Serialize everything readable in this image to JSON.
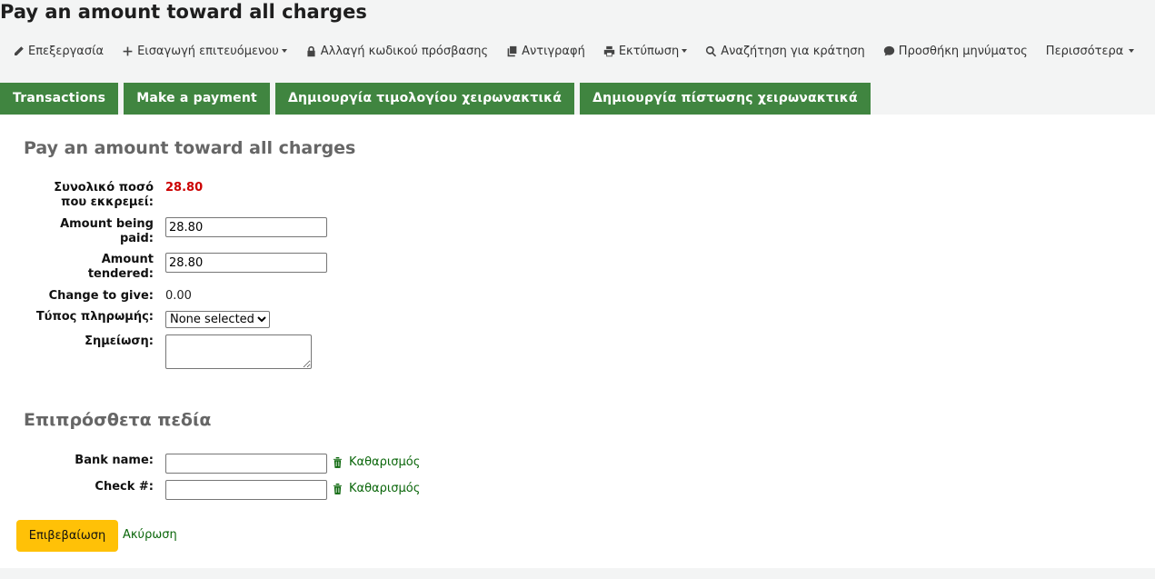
{
  "page": {
    "title": "Pay an amount toward all charges"
  },
  "toolbar": {
    "items": [
      {
        "label": "Επεξεργασία",
        "icon": "pencil-icon"
      },
      {
        "label": "Εισαγωγή επιτευόμενου",
        "icon": "plus-icon"
      },
      {
        "label": "Αλλαγή κωδικού πρόσβασης",
        "icon": "lock-icon"
      },
      {
        "label": "Αντιγραφή",
        "icon": "copy-icon"
      },
      {
        "label": "Εκτύπωση",
        "icon": "print-icon"
      },
      {
        "label": "Αναζήτηση για κράτηση",
        "icon": "search-icon"
      },
      {
        "label": "Προσθήκη μηνύματος",
        "icon": "comment-icon"
      },
      {
        "label": "Περισσότερα",
        "icon": ""
      }
    ]
  },
  "tabs": [
    {
      "label": "Transactions"
    },
    {
      "label": "Make a payment"
    },
    {
      "label": "Δημιουργία τιμολογίου χειρωνακτικά"
    },
    {
      "label": "Δημιουργία πίστωσης χειρωνακτικά"
    }
  ],
  "form": {
    "heading": "Pay an amount toward all charges",
    "outstanding_label_1": "Συνολικό ποσό",
    "outstanding_label_2": "που εκκρεμεί:",
    "outstanding_value": "28.80",
    "paid_label_1": "Amount being",
    "paid_label_2": "paid:",
    "paid_value": "28.80",
    "tendered_label_1": "Amount",
    "tendered_label_2": "tendered:",
    "tendered_value": "28.80",
    "change_label": "Change to give:",
    "change_value": "0.00",
    "payment_type_label": "Τύπος πληρωμής:",
    "payment_type_selected": "None selected",
    "note_label": "Σημείωση:"
  },
  "extra": {
    "heading": "Επιπρόσθετα πεδία",
    "bank_label": "Bank name:",
    "check_label": "Check #:",
    "clear_label": "Καθαρισμός"
  },
  "actions": {
    "confirm": "Επιβεβαίωση",
    "cancel": "Ακύρωση"
  },
  "colors": {
    "tab_bg": "#408540",
    "confirm_bg": "#ffc107",
    "outstanding": "#cc0000",
    "link": "#0a660a"
  }
}
